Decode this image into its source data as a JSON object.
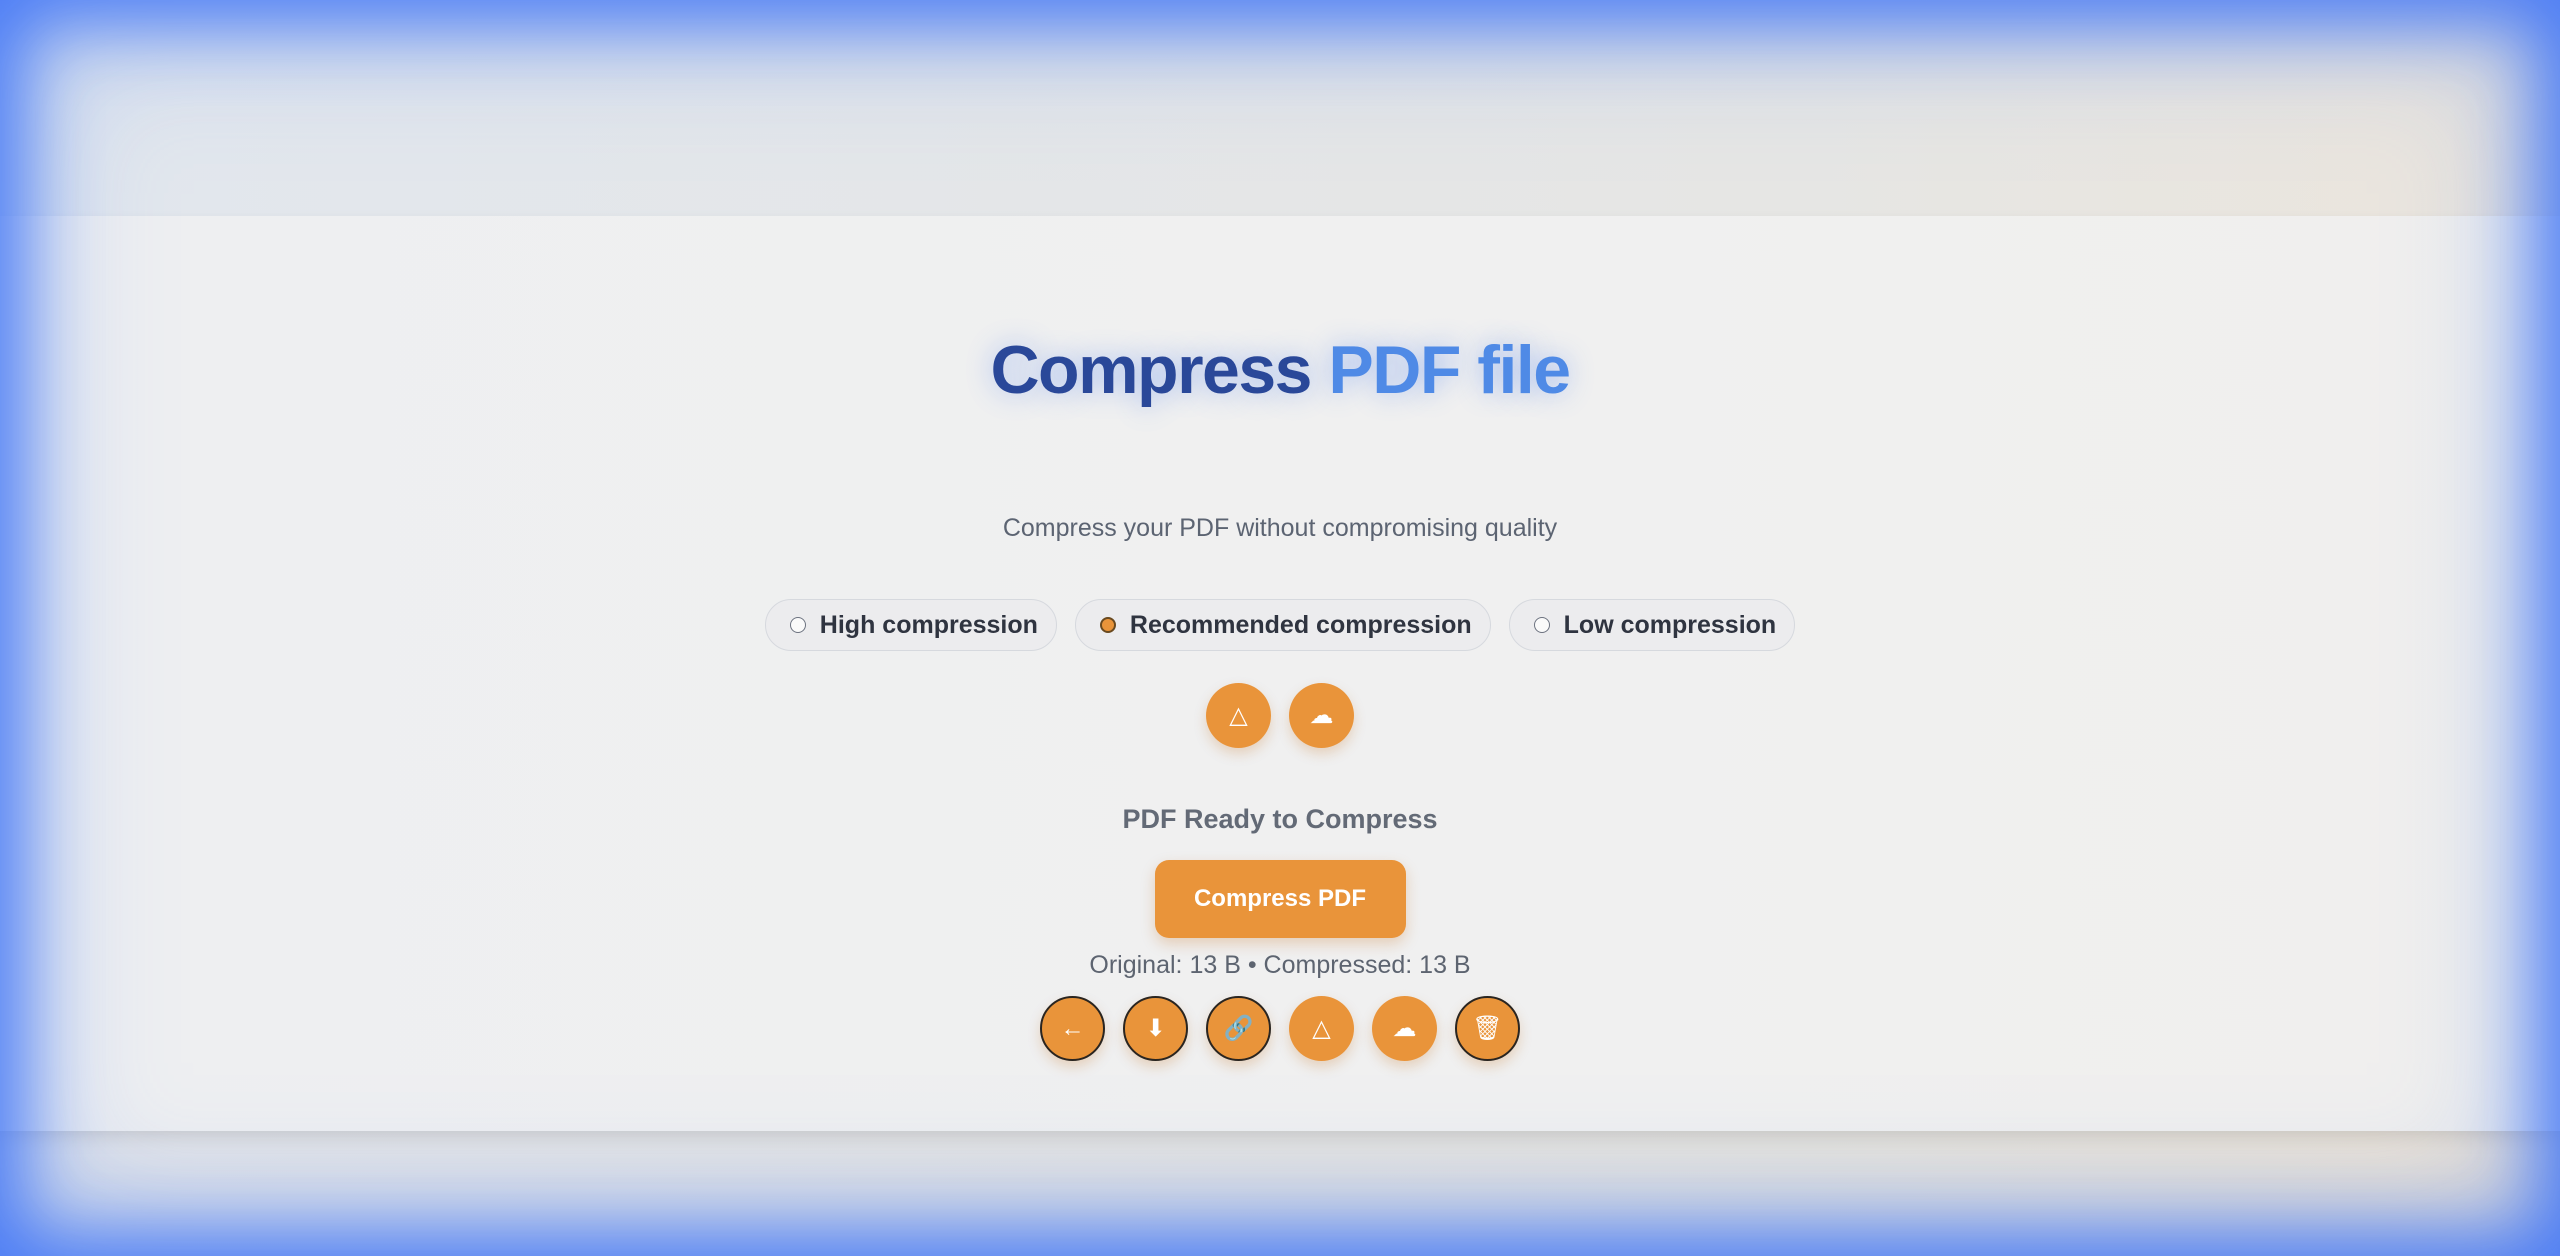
{
  "page": {
    "title_part1": "Compress",
    "title_part2": "PDF file",
    "subtitle": "Compress your PDF without compromising quality"
  },
  "compression_options": [
    {
      "label": "High compression",
      "selected": false
    },
    {
      "label": "Recommended compression",
      "selected": true
    },
    {
      "label": "Low compression",
      "selected": false
    }
  ],
  "upload_sources": [
    {
      "icon": "google-drive-icon",
      "glyph": "△"
    },
    {
      "icon": "cloud-icon",
      "glyph": "☁"
    }
  ],
  "status": "PDF Ready to Compress",
  "compress_button": "Compress PDF",
  "sizes": {
    "original_label": "Original:",
    "original_value": "13 B",
    "separator": "•",
    "compressed_label": "Compressed:",
    "compressed_value": "13 B"
  },
  "result_actions": [
    {
      "icon": "arrow-left-icon",
      "glyph": "←"
    },
    {
      "icon": "download-icon",
      "glyph": "⬇"
    },
    {
      "icon": "link-icon",
      "glyph": "🔗"
    },
    {
      "icon": "google-drive-icon",
      "glyph": "△"
    },
    {
      "icon": "cloud-icon",
      "glyph": "☁"
    },
    {
      "icon": "trash-icon",
      "glyph": "🗑"
    }
  ],
  "colors": {
    "accent": "#e9943a",
    "title_dark": "#2a4899",
    "title_light": "#4f8ae6"
  }
}
